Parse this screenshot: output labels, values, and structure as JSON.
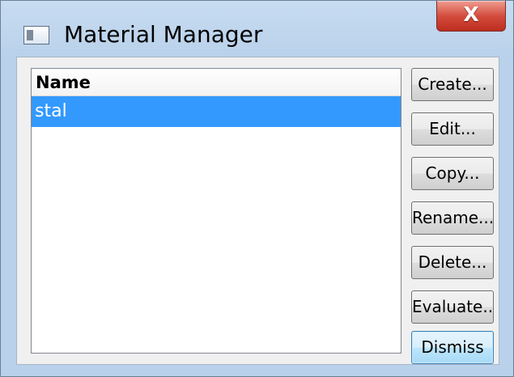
{
  "window": {
    "title": "Material Manager",
    "close_label": "X",
    "icon": "window-app-icon"
  },
  "list": {
    "column_header": "Name",
    "items": [
      {
        "label": "stal",
        "selected": true
      }
    ]
  },
  "buttons": {
    "create": "Create...",
    "edit": "Edit...",
    "copy": "Copy...",
    "rename": "Rename...",
    "delete": "Delete...",
    "evaluate": "Evaluate...",
    "dismiss": "Dismiss"
  },
  "colors": {
    "selection": "#3399ff",
    "frame": "#b9d1ea",
    "close_button": "#d24b3c"
  }
}
